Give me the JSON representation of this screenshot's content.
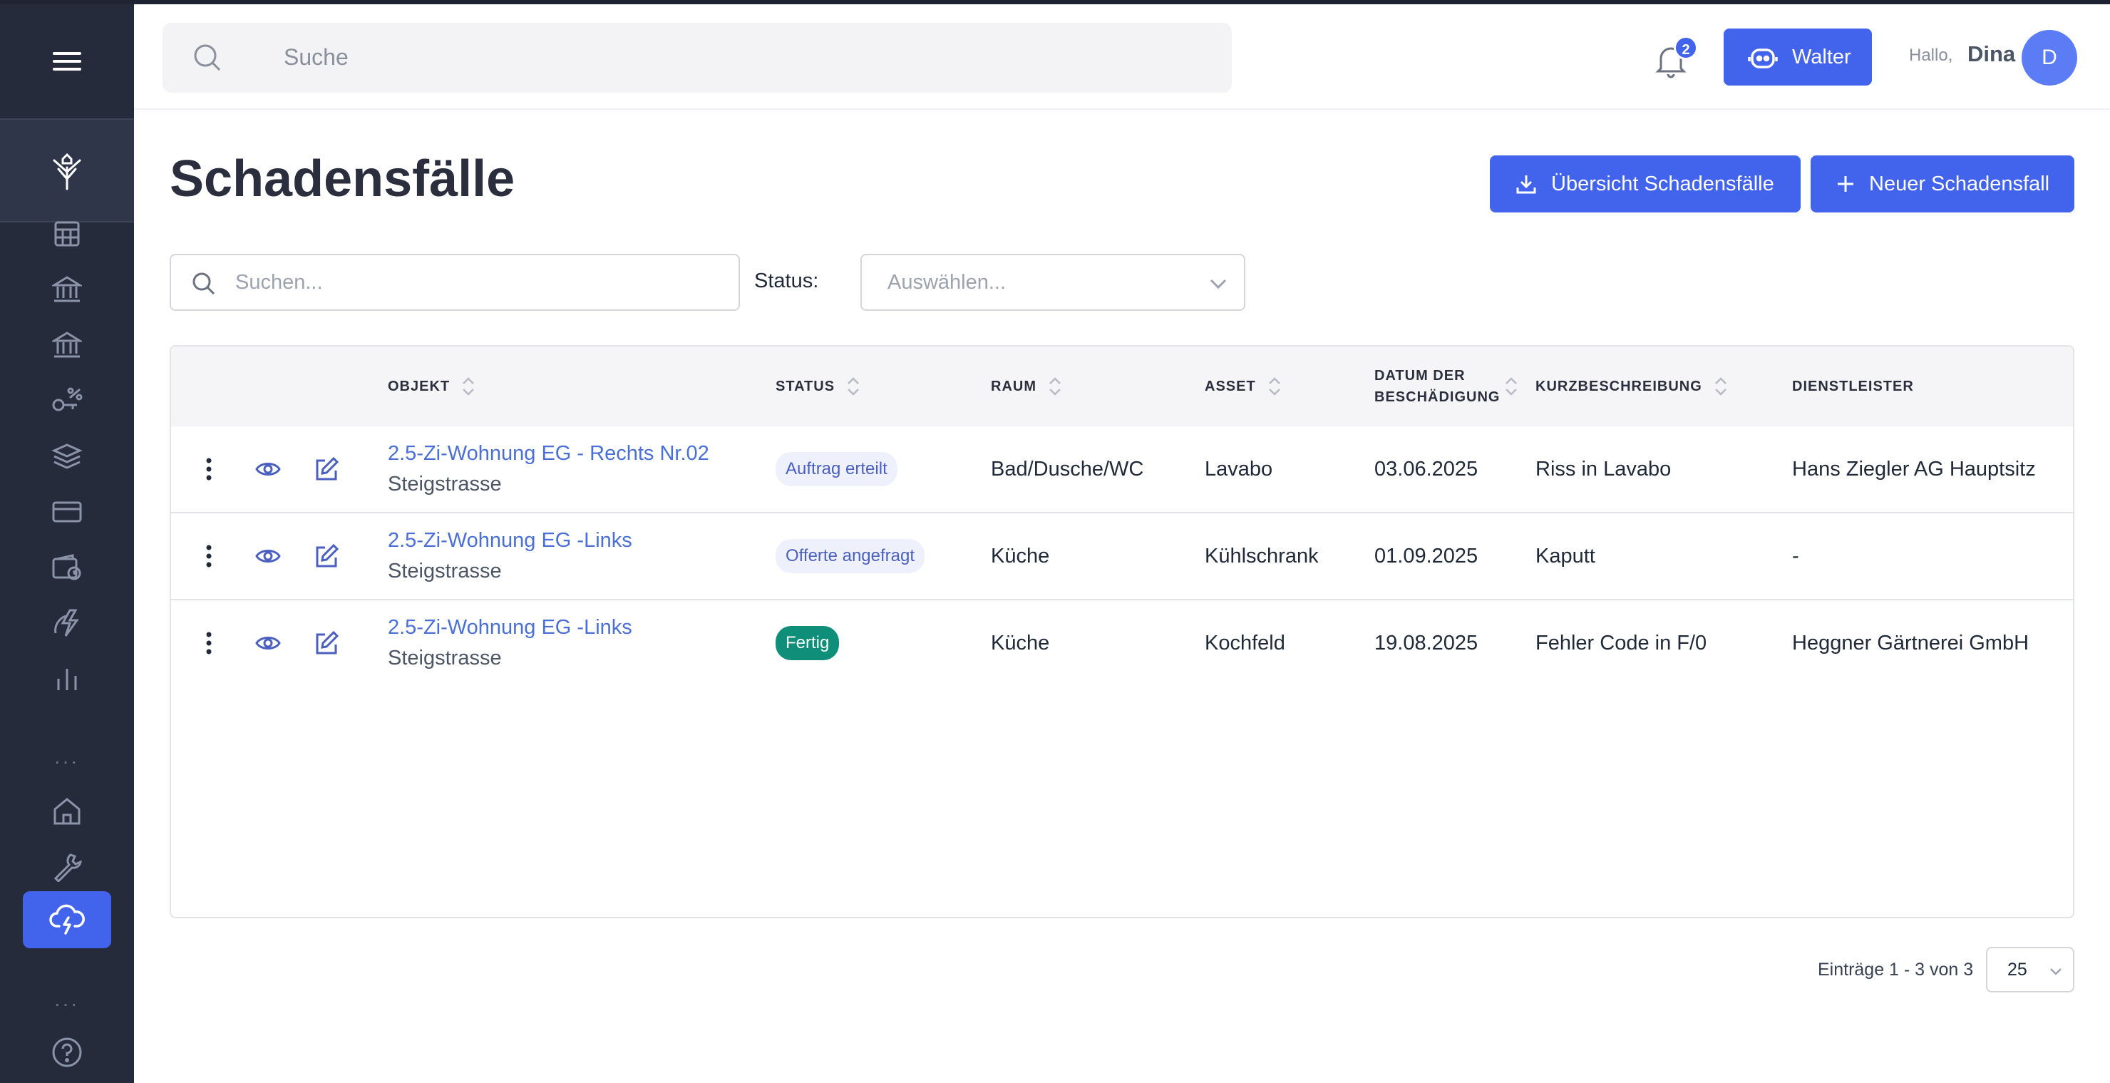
{
  "header": {
    "search_placeholder": "Suche",
    "notification_count": "2",
    "assistant_label": "Walter",
    "greeting": "Hallo,",
    "user_name": "Dina",
    "avatar_initial": "D"
  },
  "sidebar": {
    "items": [
      {
        "icon": "calculator-icon"
      },
      {
        "icon": "bank-icon"
      },
      {
        "icon": "bank-icon"
      },
      {
        "icon": "key-percent-icon"
      },
      {
        "icon": "coins-stack-icon"
      },
      {
        "icon": "credit-card-icon"
      },
      {
        "icon": "wallet-icon"
      },
      {
        "icon": "lightning-icon"
      },
      {
        "icon": "bar-chart-icon"
      },
      {
        "icon": "home-icon"
      },
      {
        "icon": "wrench-icon"
      },
      {
        "icon": "cloud-lightning-icon",
        "active": true
      },
      {
        "icon": "help-icon"
      }
    ],
    "dots": "..."
  },
  "page": {
    "title": "Schadensfälle",
    "export_button": "Übersicht Schadensfälle",
    "new_button": "Neuer Schadensfall"
  },
  "filters": {
    "search_placeholder": "Suchen...",
    "status_label": "Status:",
    "status_placeholder": "Auswählen..."
  },
  "table": {
    "headers": {
      "objekt": "OBJEKT",
      "status": "STATUS",
      "raum": "RAUM",
      "asset": "ASSET",
      "datum_line1": "DATUM DER",
      "datum_line2": "BESCHÄDIGUNG",
      "kurz": "KURZBESCHREIBUNG",
      "dienst": "DIENSTLEISTER"
    },
    "rows": [
      {
        "objekt": "2.5-Zi-Wohnung EG - Rechts Nr.02",
        "strasse": "Steigstrasse",
        "status": "Auftrag erteilt",
        "raum": "Bad/Dusche/WC",
        "asset": "Lavabo",
        "datum": "03.06.2025",
        "kurz": "Riss in Lavabo",
        "dienst": "Hans Ziegler AG Hauptsitz"
      },
      {
        "objekt": "2.5-Zi-Wohnung EG -Links",
        "strasse": "Steigstrasse",
        "status": "Offerte angefragt",
        "raum": "Küche",
        "asset": "Kühlschrank",
        "datum": "01.09.2025",
        "kurz": "Kaputt",
        "dienst": "-"
      },
      {
        "objekt": "2.5-Zi-Wohnung EG -Links",
        "strasse": "Steigstrasse",
        "status": "Fertig",
        "raum": "Küche",
        "asset": "Kochfeld",
        "datum": "19.08.2025",
        "kurz": "Fehler Code in F/0",
        "dienst": "Heggner Gärtnerei GmbH"
      }
    ]
  },
  "pagination": {
    "summary": "Einträge 1 - 3 von 3",
    "page_size": "25"
  },
  "colors": {
    "accent": "#4263eb",
    "sidebar": "#262b3b",
    "done": "#0f8f7a"
  }
}
